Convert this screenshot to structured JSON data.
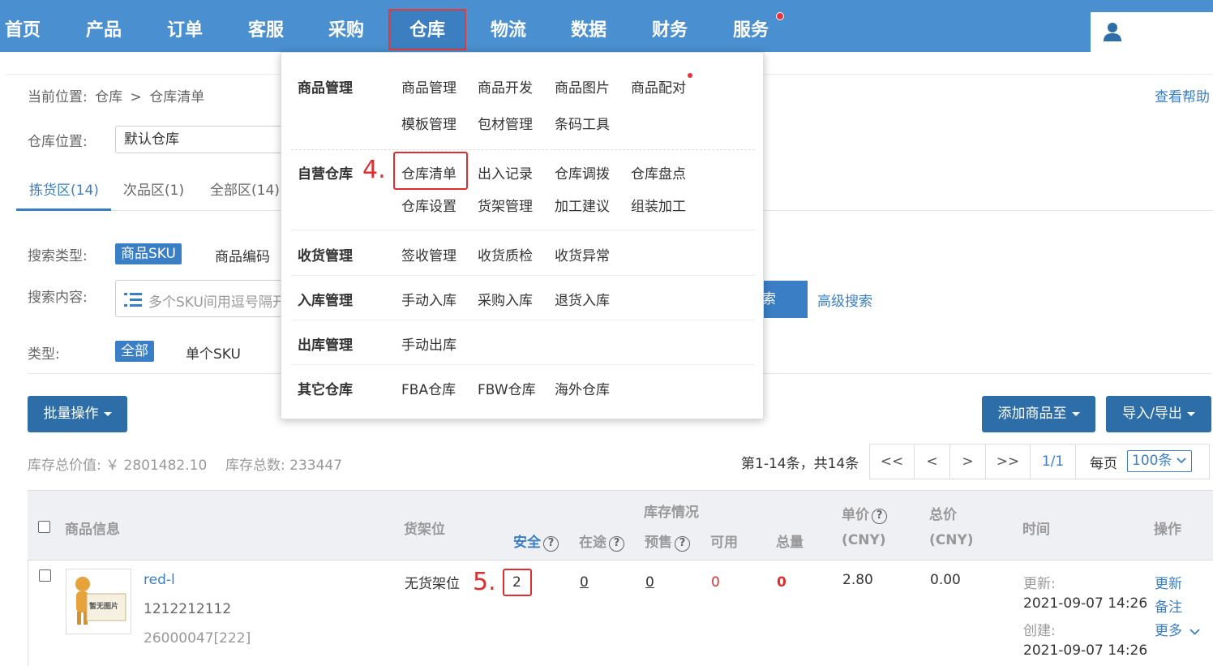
{
  "nav": {
    "items": [
      "首页",
      "产品",
      "订单",
      "客服",
      "采购",
      "仓库",
      "物流",
      "数据",
      "财务",
      "服务"
    ],
    "active": "仓库"
  },
  "breadcrumb": {
    "label": "当前位置:",
    "path1": "仓库",
    "sep": ">",
    "path2": "仓库清单",
    "help": "查看帮助"
  },
  "filters": {
    "warehouse_label": "仓库位置:",
    "warehouse_value": "默认仓库",
    "tabs": [
      "拣货区(14)",
      "次品区(1)",
      "全部区(14)"
    ],
    "search_type_label": "搜索类型:",
    "search_type_selected": "商品SKU",
    "search_type_other": "商品编码",
    "search_content_label": "搜索内容:",
    "search_placeholder": "多个SKU间用逗号隔开",
    "search_btn": "搜索",
    "search_btn_visible": "索",
    "advanced": "高级搜索",
    "type_label": "类型:",
    "type_selected": "全部",
    "type_other": "单个SKU"
  },
  "toolbar": {
    "batch": "批量操作",
    "add_to": "添加商品至",
    "import_export": "导入/导出"
  },
  "stats": {
    "total_value": "库存总价值: ￥ 2801482.10",
    "total_count": "库存总数: 233447",
    "range": "第1-14条，共14条",
    "pager": [
      "<<",
      "<",
      ">",
      ">>",
      "1/1"
    ],
    "per_page_label": "每页",
    "per_page_value": "100条"
  },
  "table": {
    "headers": {
      "product": "商品信息",
      "shelf": "货架位",
      "stock_group": "库存情况",
      "safe": "安全",
      "transit": "在途",
      "presale": "预售",
      "available": "可用",
      "total_qty": "总量",
      "unit_price": "单价",
      "unit_price_cny": "(CNY)",
      "total_price": "总价",
      "total_price_cny": "(CNY)",
      "time": "时间",
      "ops": "操作"
    },
    "row": {
      "thumb_text": "暂无图片",
      "name": "red-l",
      "code": "1212212112",
      "barcode": "26000047[222]",
      "shelf": "无货架位",
      "safe": "2",
      "transit": "0",
      "presale": "0",
      "available": "0",
      "total_qty": "0",
      "unit_price": "2.80",
      "total_price": "0.00",
      "updated_label": "更新:",
      "updated": "2021-09-07 14:26",
      "created_label": "创建:",
      "created": "2021-09-07 14:26",
      "op_update": "更新",
      "op_note": "备注",
      "op_more": "更多"
    }
  },
  "annotations": {
    "step4": "4.",
    "step5": "5."
  },
  "dropdown": {
    "sections": [
      {
        "title": "商品管理",
        "rows": [
          [
            "商品管理",
            "商品开发",
            "商品图片",
            "商品配对"
          ],
          [
            "模板管理",
            "包材管理",
            "条码工具"
          ]
        ]
      },
      {
        "title": "自营仓库",
        "rows": [
          [
            "仓库清单",
            "出入记录",
            "仓库调拨",
            "仓库盘点"
          ],
          [
            "仓库设置",
            "货架管理",
            "加工建议",
            "组装加工"
          ]
        ]
      },
      {
        "title": "收货管理",
        "rows": [
          [
            "签收管理",
            "收货质检",
            "收货异常"
          ]
        ]
      },
      {
        "title": "入库管理",
        "rows": [
          [
            "手动入库",
            "采购入库",
            "退货入库"
          ]
        ]
      },
      {
        "title": "出库管理",
        "rows": [
          [
            "手动出库"
          ]
        ]
      },
      {
        "title": "其它仓库",
        "rows": [
          [
            "FBA仓库",
            "FBW仓库",
            "海外仓库"
          ]
        ]
      }
    ]
  },
  "colors": {
    "nav_bg": "#4a8fd0",
    "accent": "#3a7fc6",
    "highlight": "#e02e2e"
  }
}
